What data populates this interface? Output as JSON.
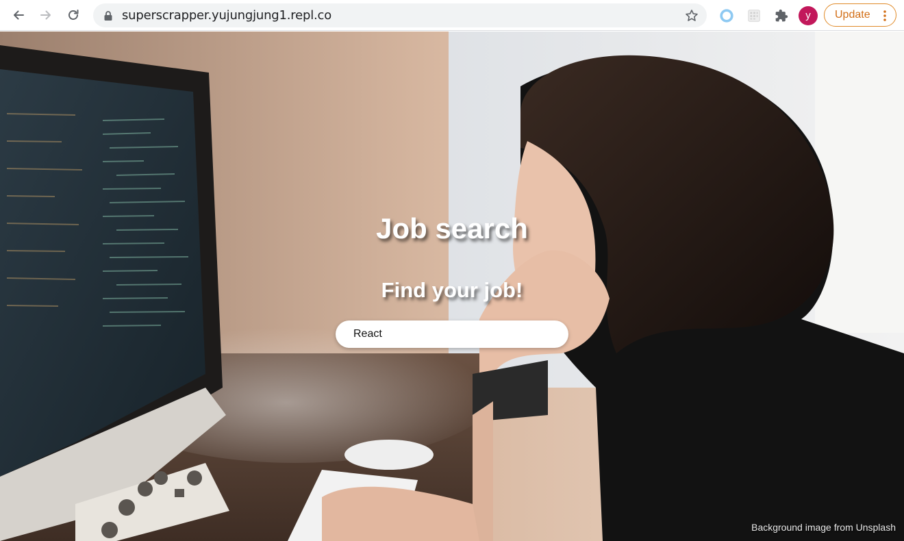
{
  "browser": {
    "url": "superscrapper.yujungjung1.repl.co",
    "profile_initial": "y",
    "update_label": "Update",
    "icons": [
      "back-arrow-icon",
      "forward-arrow-icon",
      "reload-icon",
      "lock-icon",
      "bookmark-star-icon",
      "extension-circle-icon",
      "extension-grid-icon",
      "puzzle-icon",
      "kebab-menu-icon"
    ],
    "colors": {
      "avatar": "#c2185b",
      "update_accent": "#e08a28"
    }
  },
  "page": {
    "title": "Job search",
    "subtitle": "Find your job!",
    "search": {
      "value": "React"
    },
    "credit": "Background image from Unsplash"
  }
}
